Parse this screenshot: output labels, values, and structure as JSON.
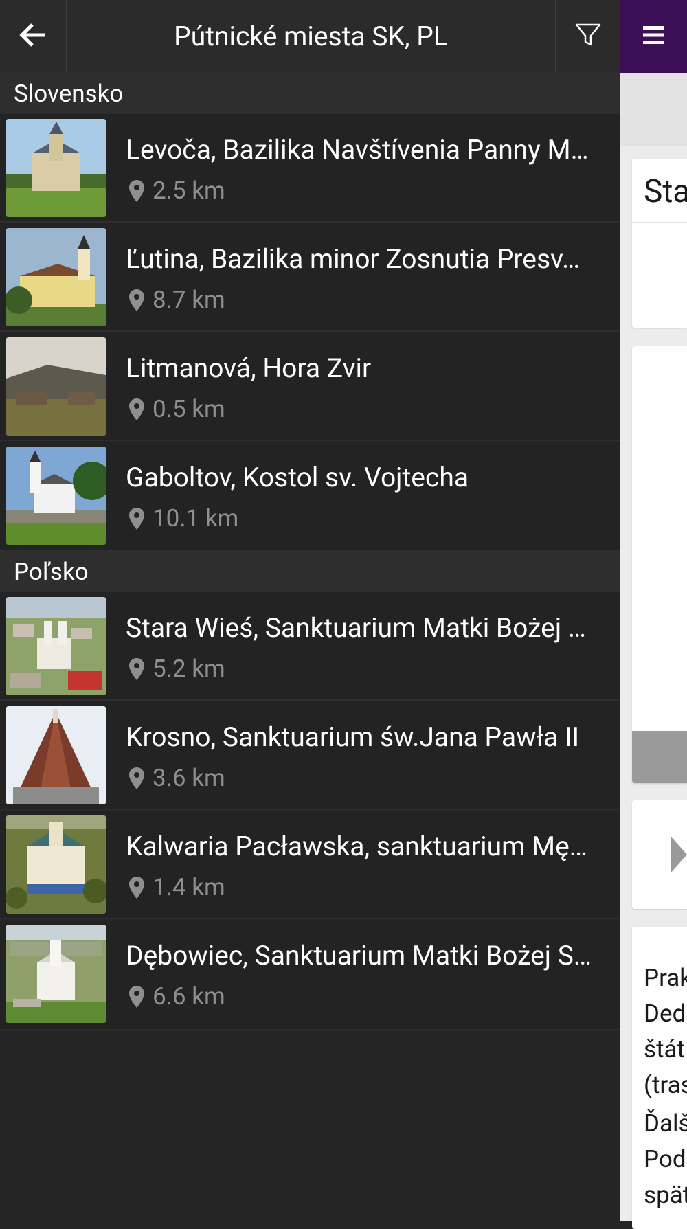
{
  "header": {
    "title": "Pútnické miesta SK, PL",
    "back_icon": "arrow-left-icon",
    "filter_icon": "filter-icon",
    "menu_icon": "hamburger-menu-icon"
  },
  "colors": {
    "accent": "#3d0f57",
    "background": "#252525",
    "distance_text": "#8f8f8f"
  },
  "sections": [
    {
      "name": "Slovensko",
      "items": [
        {
          "title": "Levoča, Bazilika Navštívenia Panny M…",
          "distance": "2.5 km"
        },
        {
          "title": "Ľutina, Bazilika minor Zosnutia Presv…",
          "distance": "8.7 km"
        },
        {
          "title": "Litmanová, Hora Zvir",
          "distance": "0.5 km"
        },
        {
          "title": "Gaboltov, Kostol sv. Vojtecha",
          "distance": "10.1 km"
        }
      ]
    },
    {
      "name": "Poľsko",
      "items": [
        {
          "title": "Stara Wieś, Sanktuarium Matki Bożej …",
          "distance": "5.2 km"
        },
        {
          "title": "Krosno, Sanktuarium św.Jana Pawła II",
          "distance": "3.6 km"
        },
        {
          "title": "Kalwaria Pacławska, sanktuarium Mę…",
          "distance": "1.4 km"
        },
        {
          "title": "Dębowiec, Sanktuarium Matki Bożej S…",
          "distance": "6.6 km"
        }
      ]
    }
  ],
  "background_page": {
    "card_heading": "Sta",
    "para1": [
      "Prak",
      "Ded",
      "štát",
      "(tras"
    ],
    "para2": [
      "Ďalš",
      "Pod",
      "spät"
    ]
  }
}
